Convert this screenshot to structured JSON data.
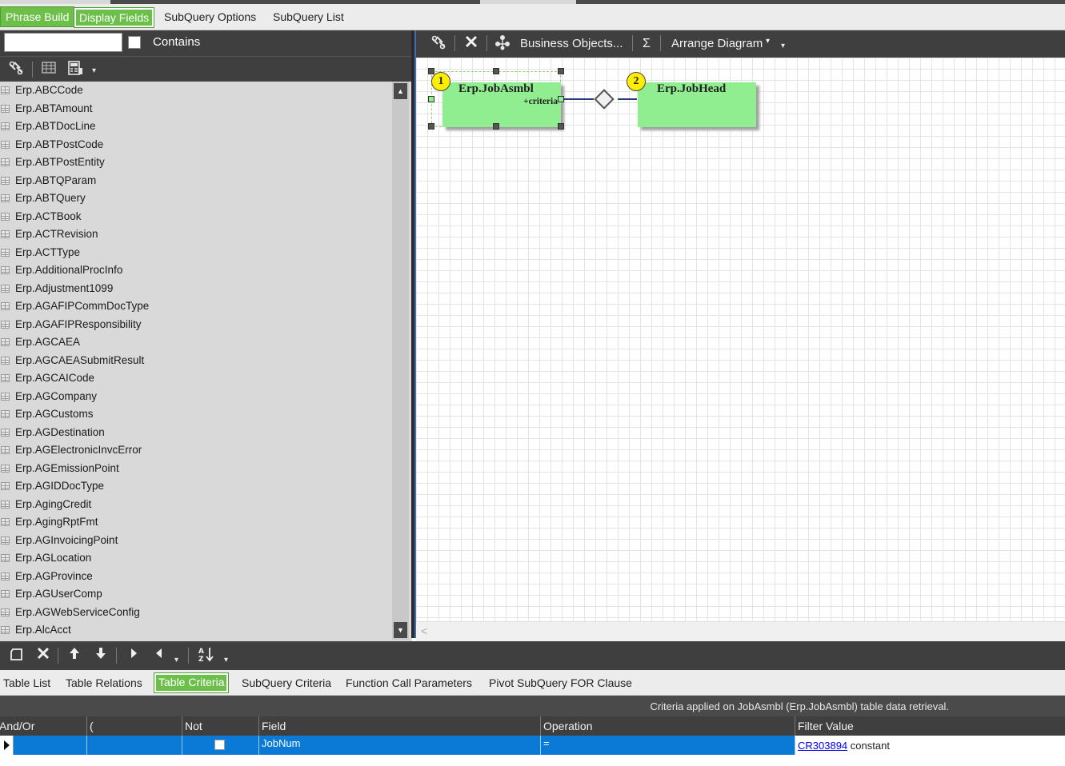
{
  "top_tabs": {
    "phrase_build": "Phrase Build",
    "display_fields": "Display Fields",
    "subquery_options": "SubQuery Options",
    "subquery_list": "SubQuery List"
  },
  "left": {
    "search_value": "",
    "contains_label": "Contains",
    "tables": [
      "Erp.ABCCode",
      "Erp.ABTAmount",
      "Erp.ABTDocLine",
      "Erp.ABTPostCode",
      "Erp.ABTPostEntity",
      "Erp.ABTQParam",
      "Erp.ABTQuery",
      "Erp.ACTBook",
      "Erp.ACTRevision",
      "Erp.ACTType",
      "Erp.AdditionalProcInfo",
      "Erp.Adjustment1099",
      "Erp.AGAFIPCommDocType",
      "Erp.AGAFIPResponsibility",
      "Erp.AGCAEA",
      "Erp.AGCAEASubmitResult",
      "Erp.AGCAICode",
      "Erp.AGCompany",
      "Erp.AGCustoms",
      "Erp.AGDestination",
      "Erp.AGElectronicInvcError",
      "Erp.AGEmissionPoint",
      "Erp.AGIDDocType",
      "Erp.AgingCredit",
      "Erp.AgingRptFmt",
      "Erp.AGInvoicingPoint",
      "Erp.AGLocation",
      "Erp.AGProvince",
      "Erp.AGUserComp",
      "Erp.AGWebServiceConfig",
      "Erp.AlcAcct"
    ]
  },
  "diagram": {
    "toolbar": {
      "business_objects": "Business Objects...",
      "sigma": "Σ",
      "arrange": "Arrange Diagram"
    },
    "nodes": [
      {
        "badge": "1",
        "title": "Erp.JobAsmbl",
        "sub": "+criteria"
      },
      {
        "badge": "2",
        "title": "Erp.JobHead"
      }
    ]
  },
  "bottom_tabs": {
    "table_list": "Table List",
    "table_relations": "Table Relations",
    "table_criteria": "Table Criteria",
    "subquery_criteria": "SubQuery Criteria",
    "function_call_parameters": "Function Call Parameters",
    "pivot": "Pivot SubQuery FOR Clause"
  },
  "criteria": {
    "info": "Criteria applied on JobAsmbl (Erp.JobAsmbl) table data retrieval.",
    "headers": {
      "and_or": "And/Or",
      "paren": "(",
      "not": "Not",
      "field": "Field",
      "operation": "Operation",
      "filter_value": "Filter Value"
    },
    "row": {
      "field": "JobNum",
      "operation": "=",
      "filter_link": "CR303894",
      "filter_type": "constant"
    }
  },
  "colors": {
    "accent_green": "#6cc04a",
    "node_green": "#90ee90",
    "selection_blue": "#0a7ad6",
    "toolbar_dark": "#3f3f3f"
  }
}
